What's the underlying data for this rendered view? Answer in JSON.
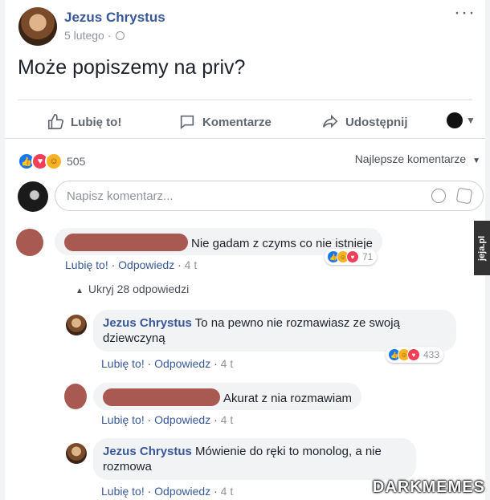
{
  "post": {
    "author": "Jezus Chrystus",
    "date": "5 lutego",
    "text": "Może popiszemy na priv?",
    "menu": "···"
  },
  "actions": {
    "like": "Lubię to!",
    "comment": "Komentarze",
    "share": "Udostępnij"
  },
  "reactions": {
    "count": "505"
  },
  "sort_label": "Najlepsze komentarze",
  "comment_input": {
    "placeholder": "Napisz komentarz..."
  },
  "comments": [
    {
      "text": "Nie gadam z czyms co nie istnieje",
      "like": "Lubię to!",
      "reply": "Odpowiedz",
      "time": "4 t",
      "reactions": "71"
    }
  ],
  "hide_replies": "Ukryj 28 odpowiedzi",
  "replies": [
    {
      "name": "Jezus Chrystus",
      "text": "To na pewno nie rozmawiasz ze swoją dziewczyną",
      "like": "Lubię to!",
      "reply": "Odpowiedz",
      "time": "4 t",
      "reactions": "433"
    },
    {
      "name": "",
      "text": "Akurat z nia rozmawiam",
      "like": "Lubię to!",
      "reply": "Odpowiedz",
      "time": "4 t"
    },
    {
      "name": "Jezus Chrystus",
      "text": "Mówienie do ręki to monolog, a nie rozmowa",
      "like": "Lubię to!",
      "reply": "Odpowiedz",
      "time": "4 t"
    }
  ],
  "watermarks": {
    "side": "jeja.pl",
    "bottom": "DARKMEMES"
  },
  "colors": {
    "link": "#385898",
    "bg": "#f2f3f5",
    "redaction": "#a85a52"
  }
}
